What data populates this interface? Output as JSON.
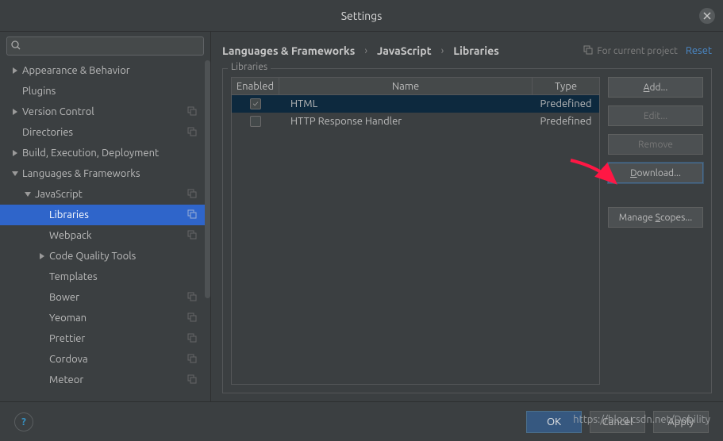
{
  "titlebar": {
    "title": "Settings"
  },
  "search": {
    "placeholder": ""
  },
  "sidebar": {
    "items": [
      {
        "label": "Appearance & Behavior",
        "depth": 0,
        "arrow": "right",
        "copy": false
      },
      {
        "label": "Plugins",
        "depth": 0,
        "arrow": "none",
        "copy": false
      },
      {
        "label": "Version Control",
        "depth": 0,
        "arrow": "right",
        "copy": true
      },
      {
        "label": "Directories",
        "depth": 0,
        "arrow": "none",
        "copy": true
      },
      {
        "label": "Build, Execution, Deployment",
        "depth": 0,
        "arrow": "right",
        "copy": false
      },
      {
        "label": "Languages & Frameworks",
        "depth": 0,
        "arrow": "down",
        "copy": false
      },
      {
        "label": "JavaScript",
        "depth": 1,
        "arrow": "down",
        "copy": true
      },
      {
        "label": "Libraries",
        "depth": 2,
        "arrow": "none",
        "copy": true,
        "selected": true
      },
      {
        "label": "Webpack",
        "depth": 2,
        "arrow": "none",
        "copy": true
      },
      {
        "label": "Code Quality Tools",
        "depth": 2,
        "arrow": "right",
        "copy": false
      },
      {
        "label": "Templates",
        "depth": 2,
        "arrow": "none",
        "copy": false
      },
      {
        "label": "Bower",
        "depth": 2,
        "arrow": "none",
        "copy": true
      },
      {
        "label": "Yeoman",
        "depth": 2,
        "arrow": "none",
        "copy": true
      },
      {
        "label": "Prettier",
        "depth": 2,
        "arrow": "none",
        "copy": true
      },
      {
        "label": "Cordova",
        "depth": 2,
        "arrow": "none",
        "copy": true
      },
      {
        "label": "Meteor",
        "depth": 2,
        "arrow": "none",
        "copy": true
      }
    ]
  },
  "content": {
    "breadcrumbs": [
      "Languages & Frameworks",
      "JavaScript",
      "Libraries"
    ],
    "scope_hint": "For current project",
    "reset": "Reset",
    "group_label": "Libraries",
    "columns": {
      "enabled": "Enabled",
      "name": "Name",
      "type": "Type"
    },
    "rows": [
      {
        "enabled": true,
        "name": "HTML",
        "type": "Predefined",
        "selected": true
      },
      {
        "enabled": false,
        "name": "HTTP Response Handler",
        "type": "Predefined",
        "selected": false
      }
    ],
    "buttons": {
      "add": "Add...",
      "edit": "Edit...",
      "remove": "Remove",
      "download": "Download...",
      "manage_scopes": "Manage Scopes..."
    }
  },
  "footer": {
    "ok": "OK",
    "cancel": "Cancel",
    "apply": "Apply"
  },
  "watermark": "https://blog.csdn.net/Dobility"
}
